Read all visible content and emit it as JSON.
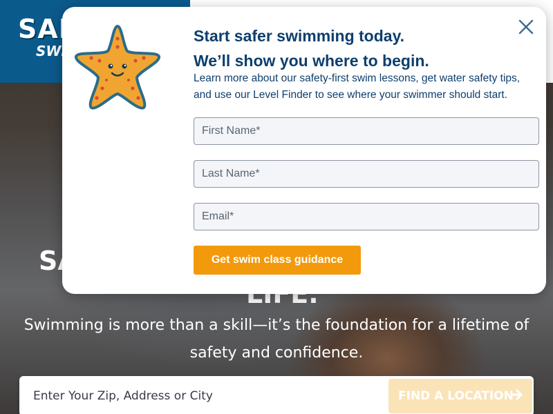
{
  "header": {
    "logo_text": "SAF",
    "logo_sub": "SWI"
  },
  "hero": {
    "heading_left": "SA",
    "heading_right": "LIFE.",
    "subtitle": "Swimming is more than a skill—it’s the foundation for a lifetime of safety and confidence."
  },
  "search": {
    "placeholder": "Enter Your Zip, Address or City",
    "button_label": "FIND A LOCATION",
    "button_icon": "arrow-right-icon"
  },
  "modal": {
    "title_line1": "Start safer swimming today.",
    "title_line2": "We’ll show you where to begin.",
    "description": "Learn more about our safety-first swim lessons, get water safety tips, and use our Level Finder to see where your swimmer should start.",
    "fields": {
      "first_name_placeholder": "First Name*",
      "last_name_placeholder": "Last Name*",
      "email_placeholder": "Email*"
    },
    "cta_label": "Get swim class guidance",
    "close_icon": "close-icon",
    "mascot_icon": "starfish-icon"
  },
  "colors": {
    "brand_blue": "#0b5a8c",
    "title_navy": "#0d3f6e",
    "cta_orange": "#f29a0c",
    "find_button_tint": "#fbe3b8"
  }
}
